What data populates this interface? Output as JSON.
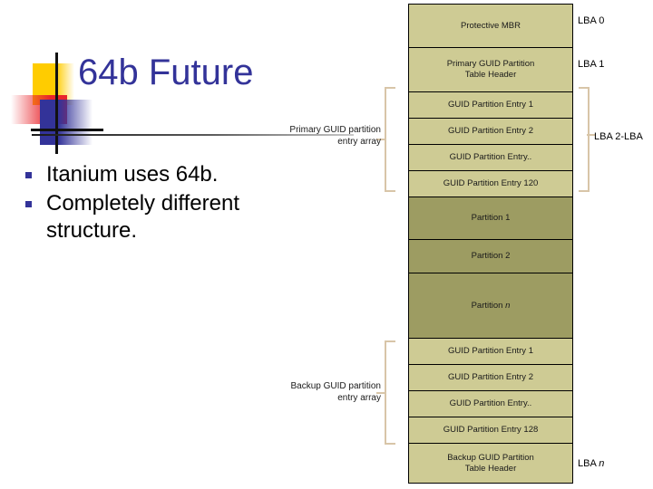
{
  "slide": {
    "title": "64b Future",
    "bullets": [
      "Itanium uses 64b.",
      "Completely different structure."
    ],
    "accent_blue": "#333399",
    "accent_yellow": "#FFCC00",
    "accent_red": "#E8242B"
  },
  "diagram": {
    "block_light_color": "#CECB94",
    "block_dark_color": "#9D9C62",
    "bracket_color": "#D8C5A8",
    "blocks": [
      {
        "label": "Protective MBR",
        "shade": "light"
      },
      {
        "label": "Primary GUID Partition\nTable Header",
        "shade": "light"
      },
      {
        "label": "GUID Partition Entry 1",
        "shade": "light"
      },
      {
        "label": "GUID Partition Entry 2",
        "shade": "light"
      },
      {
        "label": "GUID Partition Entry..",
        "shade": "light"
      },
      {
        "label": "GUID Partition Entry 120",
        "shade": "light"
      },
      {
        "label": "Partition 1",
        "shade": "dark"
      },
      {
        "label": "Partition 2",
        "shade": "dark"
      },
      {
        "label": "Partition n",
        "shade": "dark"
      },
      {
        "label": "GUID Partition Entry 1",
        "shade": "light"
      },
      {
        "label": "GUID Partition Entry 2",
        "shade": "light"
      },
      {
        "label": "GUID Partition Entry..",
        "shade": "light"
      },
      {
        "label": "GUID Partition Entry 128",
        "shade": "light"
      },
      {
        "label": "Backup GUID Partition\nTable Header",
        "shade": "light"
      }
    ],
    "block_labels": {
      "protective_mbr": "Protective MBR",
      "primary_header_line1": "Primary GUID Partition",
      "primary_header_line2": "Table Header",
      "primary_entry_1": "GUID Partition Entry 1",
      "primary_entry_2": "GUID Partition Entry 2",
      "primary_entry_dots": "GUID Partition Entry..",
      "primary_entry_last": "GUID Partition Entry 120",
      "partition_1": "Partition 1",
      "partition_2": "Partition 2",
      "partition_n_prefix": "Partition ",
      "partition_n_suffix": "n",
      "backup_entry_1": "GUID Partition Entry 1",
      "backup_entry_2": "GUID Partition Entry 2",
      "backup_entry_dots": "GUID Partition Entry..",
      "backup_entry_last": "GUID Partition Entry 128",
      "backup_header_line1": "Backup GUID Partition",
      "backup_header_line2": "Table Header"
    },
    "callouts": {
      "primary_array_line1": "Primary GUID partition",
      "primary_array_line2": "entry array",
      "backup_array_line1": "Backup GUID partition",
      "backup_array_line2": "entry array"
    },
    "lba_labels": {
      "lba_0": "LBA 0",
      "lba_1": "LBA 1",
      "lba_2_to_n": "LBA 2-LBA",
      "lba_n_prefix": "LBA ",
      "lba_n_suffix": "n"
    }
  }
}
